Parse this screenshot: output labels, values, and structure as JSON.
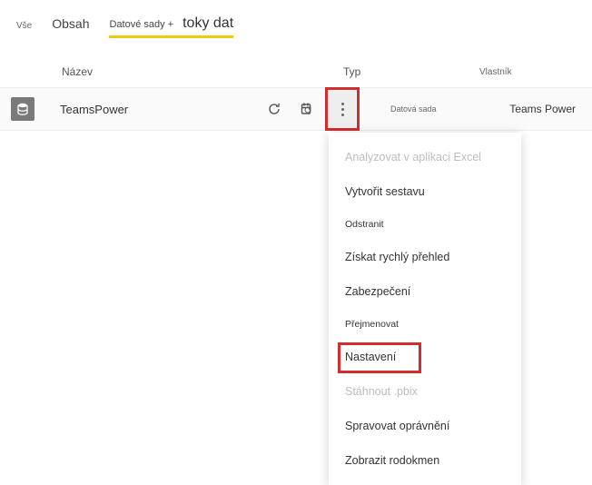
{
  "tabs": {
    "all": "Vše",
    "content": "Obsah",
    "datasets": "Datové sady +",
    "dataflows": "toky dat"
  },
  "columns": {
    "name": "Název",
    "type": "Typ",
    "owner": "Vlastník"
  },
  "row": {
    "name": "TeamsPower",
    "type": "Datová sada",
    "owner": "Teams Power"
  },
  "menu": {
    "analyze_excel": "Analyzovat v aplikaci Excel",
    "create_report": "Vytvořit sestavu",
    "delete": "Odstranit",
    "quick_insights": "Získat rychlý přehled",
    "security": "Zabezpečení",
    "rename": "Přejmenovat",
    "settings": "Nastavení",
    "download_pbix": "Stáhnout .pbix",
    "manage_permissions": "Spravovat oprávnění",
    "view_lineage": "Zobrazit rodokmen"
  }
}
